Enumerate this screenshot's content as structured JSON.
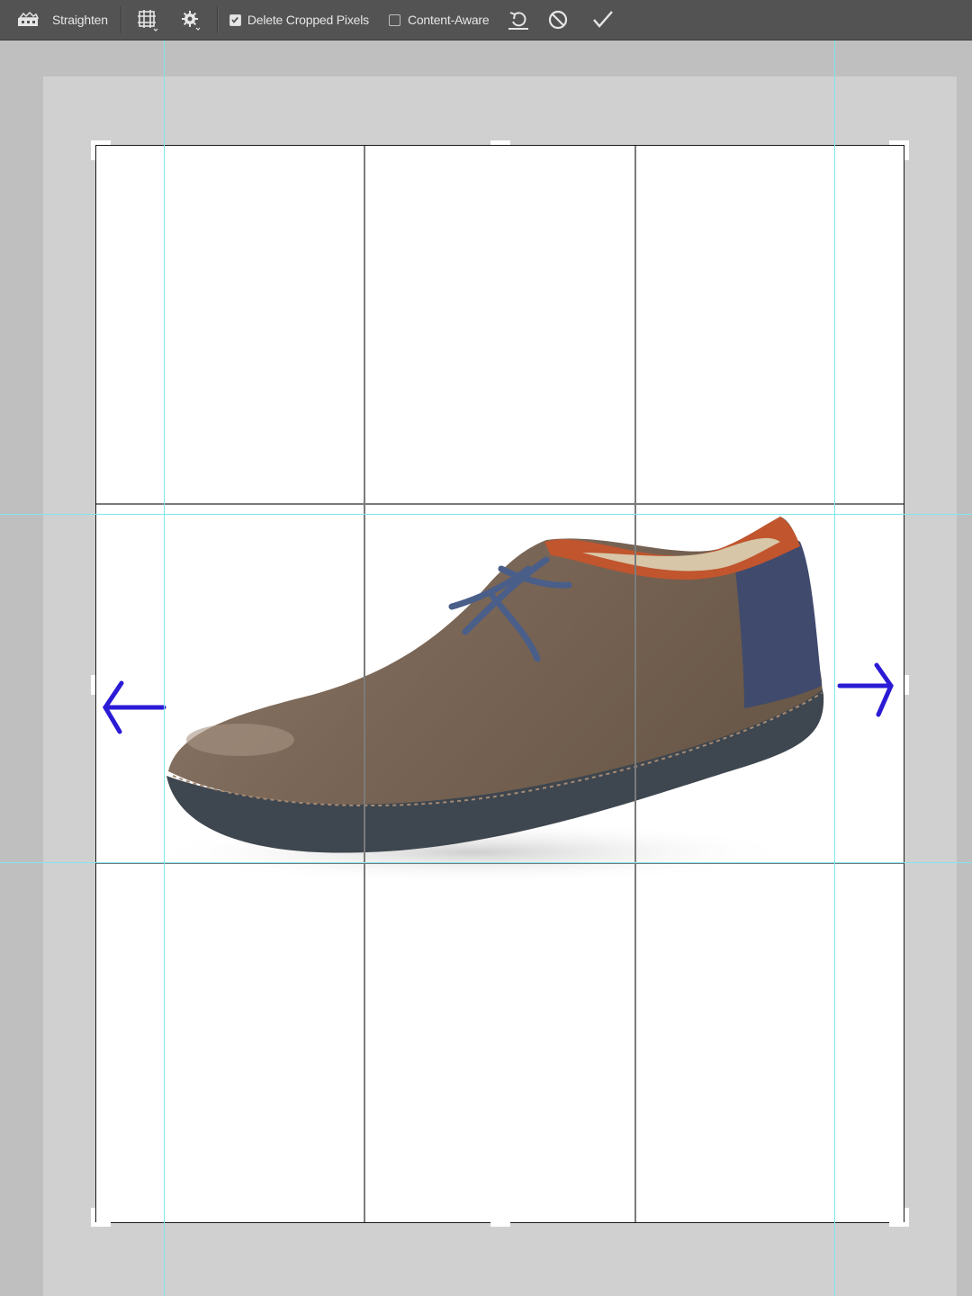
{
  "toolbar": {
    "straighten_label": "Straighten",
    "delete_cropped_label": "Delete Cropped Pixels",
    "delete_cropped_checked": true,
    "content_aware_label": "Content-Aware",
    "content_aware_checked": false,
    "icons": [
      "straighten-icon",
      "grid-overlay-icon",
      "settings-gear-icon",
      "reset-icon",
      "cancel-icon",
      "commit-check-icon"
    ]
  },
  "canvas": {
    "image_subject": "brown leather lace-up shoe",
    "annotation_arrow_color": "#2b1bd6",
    "guide_color": "#7fe6ee"
  }
}
